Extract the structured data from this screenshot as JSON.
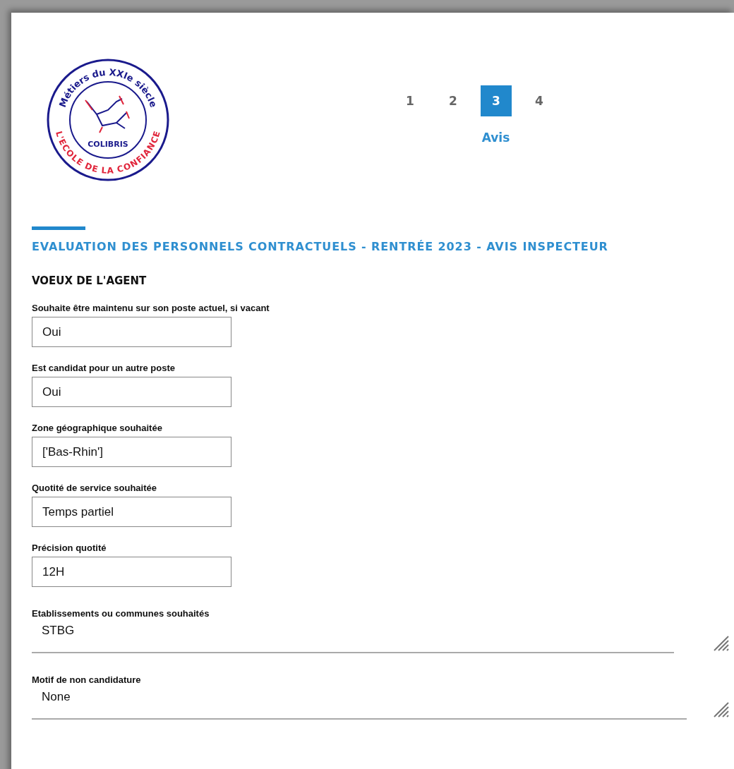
{
  "logo": {
    "top_text": "Métiers du XXIe siècle",
    "center_text": "COLIBRIS",
    "bottom_text": "L'ECOLE DE LA CONFIANCE"
  },
  "steps": [
    {
      "label": "1",
      "selected": false
    },
    {
      "label": "2",
      "selected": false
    },
    {
      "label": "3",
      "selected": true
    },
    {
      "label": "4",
      "selected": false
    }
  ],
  "step_label": "Avis",
  "title": "EVALUATION DES PERSONNELS CONTRACTUELS - RENTRÉE 2023 - AVIS INSPECTEUR",
  "section": "VOEUX DE L'AGENT",
  "fields": [
    {
      "kind": "input",
      "label": "Souhaite être maintenu sur son poste actuel, si vacant",
      "value": "Oui"
    },
    {
      "kind": "input",
      "label": "Est candidat pour un autre poste",
      "value": "Oui"
    },
    {
      "kind": "input",
      "label": "Zone géographique souhaitée",
      "value": "['Bas-Rhin']"
    },
    {
      "kind": "input",
      "label": "Quotité de service souhaitée",
      "value": "Temps partiel"
    },
    {
      "kind": "input",
      "label": "Précision quotité",
      "value": "12H"
    },
    {
      "kind": "textarea",
      "label": "Etablissements ou communes souhaités",
      "value": "STBG"
    },
    {
      "kind": "textarea",
      "label": "Motif de non candidature",
      "value": "None"
    }
  ]
}
